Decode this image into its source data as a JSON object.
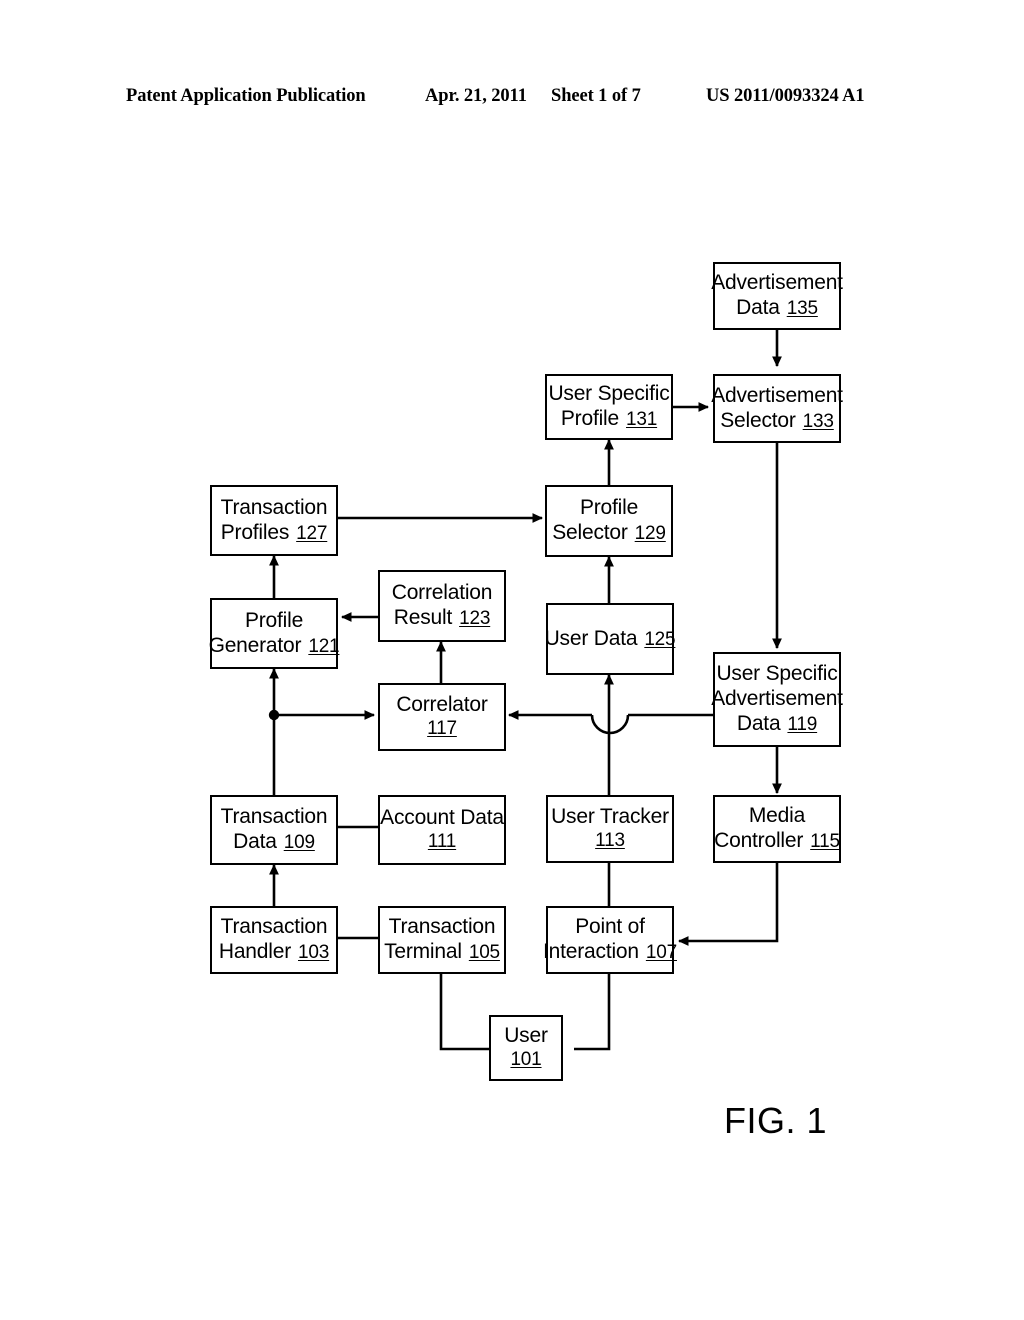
{
  "header": {
    "left": "Patent Application Publication",
    "date": "Apr. 21, 2011",
    "sheet": "Sheet 1 of 7",
    "pub_number": "US 2011/0093324 A1"
  },
  "figure": {
    "caption": "FIG. 1",
    "nodes": {
      "user": {
        "line1": "User",
        "line2": "",
        "ref": "101"
      },
      "txn_handler": {
        "line1": "Transaction",
        "line2": "Handler",
        "ref": "103"
      },
      "txn_terminal": {
        "line1": "Transaction",
        "line2": "Terminal",
        "ref": "105"
      },
      "point_of_inter": {
        "line1": "Point of",
        "line2": "Interaction",
        "ref": "107"
      },
      "txn_data": {
        "line1": "Transaction",
        "line2": "Data",
        "ref": "109"
      },
      "account_data": {
        "line1": "Account Data",
        "line2": "",
        "ref": "111"
      },
      "user_tracker": {
        "line1": "User Tracker",
        "line2": "",
        "ref": "113"
      },
      "media_ctrl": {
        "line1": "Media",
        "line2": "Controller",
        "ref": "115"
      },
      "correlator": {
        "line1": "Correlator",
        "line2": "",
        "ref": "117"
      },
      "usad": {
        "line1": "User Specific",
        "line2": "Advertisement",
        "line3": "Data",
        "ref": "119"
      },
      "profile_gen": {
        "line1": "Profile",
        "line2": "Generator",
        "ref": "121"
      },
      "corr_result": {
        "line1": "Correlation",
        "line2": "Result",
        "ref": "123"
      },
      "user_data": {
        "line1": "User Data",
        "line2": "",
        "ref": "125"
      },
      "txn_profiles": {
        "line1": "Transaction",
        "line2": "Profiles",
        "ref": "127"
      },
      "profile_sel": {
        "line1": "Profile",
        "line2": "Selector",
        "ref": "129"
      },
      "user_spec_prof": {
        "line1": "User Specific",
        "line2": "Profile",
        "ref": "131"
      },
      "ad_selector": {
        "line1": "Advertisement",
        "line2": "Selector",
        "ref": "133"
      },
      "ad_data": {
        "line1": "Advertisement",
        "line2": "Data",
        "ref": "135"
      }
    }
  }
}
